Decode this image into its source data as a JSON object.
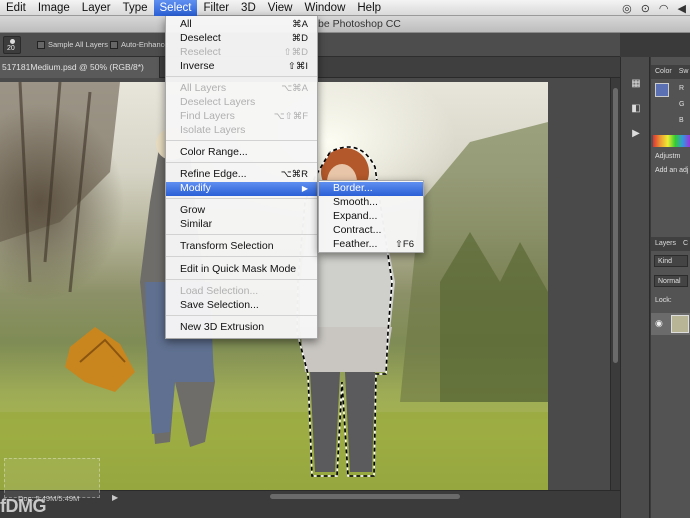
{
  "menubar": {
    "apple": "",
    "items": [
      "Edit",
      "Image",
      "Layer",
      "Type",
      "Select",
      "Filter",
      "3D",
      "View",
      "Window",
      "Help"
    ]
  },
  "window_title": "be Photoshop CC",
  "options": {
    "brush_size": "20",
    "sample_all_layers": "Sample All Layers",
    "auto_enhance": "Auto-Enhance"
  },
  "document_tab": "517181Medium.psd @ 50% (RGB/8*)",
  "status": {
    "doc": "Doc: 5.49M/5.49M"
  },
  "watermark": "fDMG",
  "right_panel": {
    "color_tab": "Color",
    "swatches_tab": "Sw",
    "r_label": "R",
    "g_label": "G",
    "b_label": "B",
    "adjustments": "Adjustm",
    "add_adjust": "Add an adj",
    "layers_tab": "Layers",
    "channels_tab": "C",
    "kind": "Kind",
    "normal": "Normal",
    "lock": "Lock:"
  },
  "select_menu": {
    "items": [
      {
        "label": "All",
        "shortcut": "⌘A",
        "enabled": true
      },
      {
        "label": "Deselect",
        "shortcut": "⌘D",
        "enabled": true
      },
      {
        "label": "Reselect",
        "shortcut": "⇧⌘D",
        "enabled": false
      },
      {
        "label": "Inverse",
        "shortcut": "⇧⌘I",
        "enabled": true
      },
      {
        "label": "All Layers",
        "shortcut": "⌥⌘A",
        "enabled": false
      },
      {
        "label": "Deselect Layers",
        "shortcut": "",
        "enabled": false
      },
      {
        "label": "Find Layers",
        "shortcut": "⌥⇧⌘F",
        "enabled": false
      },
      {
        "label": "Isolate Layers",
        "shortcut": "",
        "enabled": false
      },
      {
        "label": "Color Range...",
        "shortcut": "",
        "enabled": true
      },
      {
        "label": "Refine Edge...",
        "shortcut": "⌥⌘R",
        "enabled": true
      },
      {
        "label": "Modify",
        "shortcut": "",
        "enabled": true
      },
      {
        "label": "Grow",
        "shortcut": "",
        "enabled": true
      },
      {
        "label": "Similar",
        "shortcut": "",
        "enabled": true
      },
      {
        "label": "Transform Selection",
        "shortcut": "",
        "enabled": true
      },
      {
        "label": "Edit in Quick Mask Mode",
        "shortcut": "",
        "enabled": true
      },
      {
        "label": "Load Selection...",
        "shortcut": "",
        "enabled": false
      },
      {
        "label": "Save Selection...",
        "shortcut": "",
        "enabled": true
      },
      {
        "label": "New 3D Extrusion",
        "shortcut": "",
        "enabled": true
      }
    ]
  },
  "modify_menu": {
    "items": [
      {
        "label": "Border...",
        "shortcut": ""
      },
      {
        "label": "Smooth...",
        "shortcut": ""
      },
      {
        "label": "Expand...",
        "shortcut": ""
      },
      {
        "label": "Contract...",
        "shortcut": ""
      },
      {
        "label": "Feather...",
        "shortcut": "⇧F6"
      }
    ]
  },
  "colors": {
    "menu_highlight": "#2a5fd6",
    "panel_bg": "#535353",
    "foreground_swatch": "#5b6fb3"
  }
}
